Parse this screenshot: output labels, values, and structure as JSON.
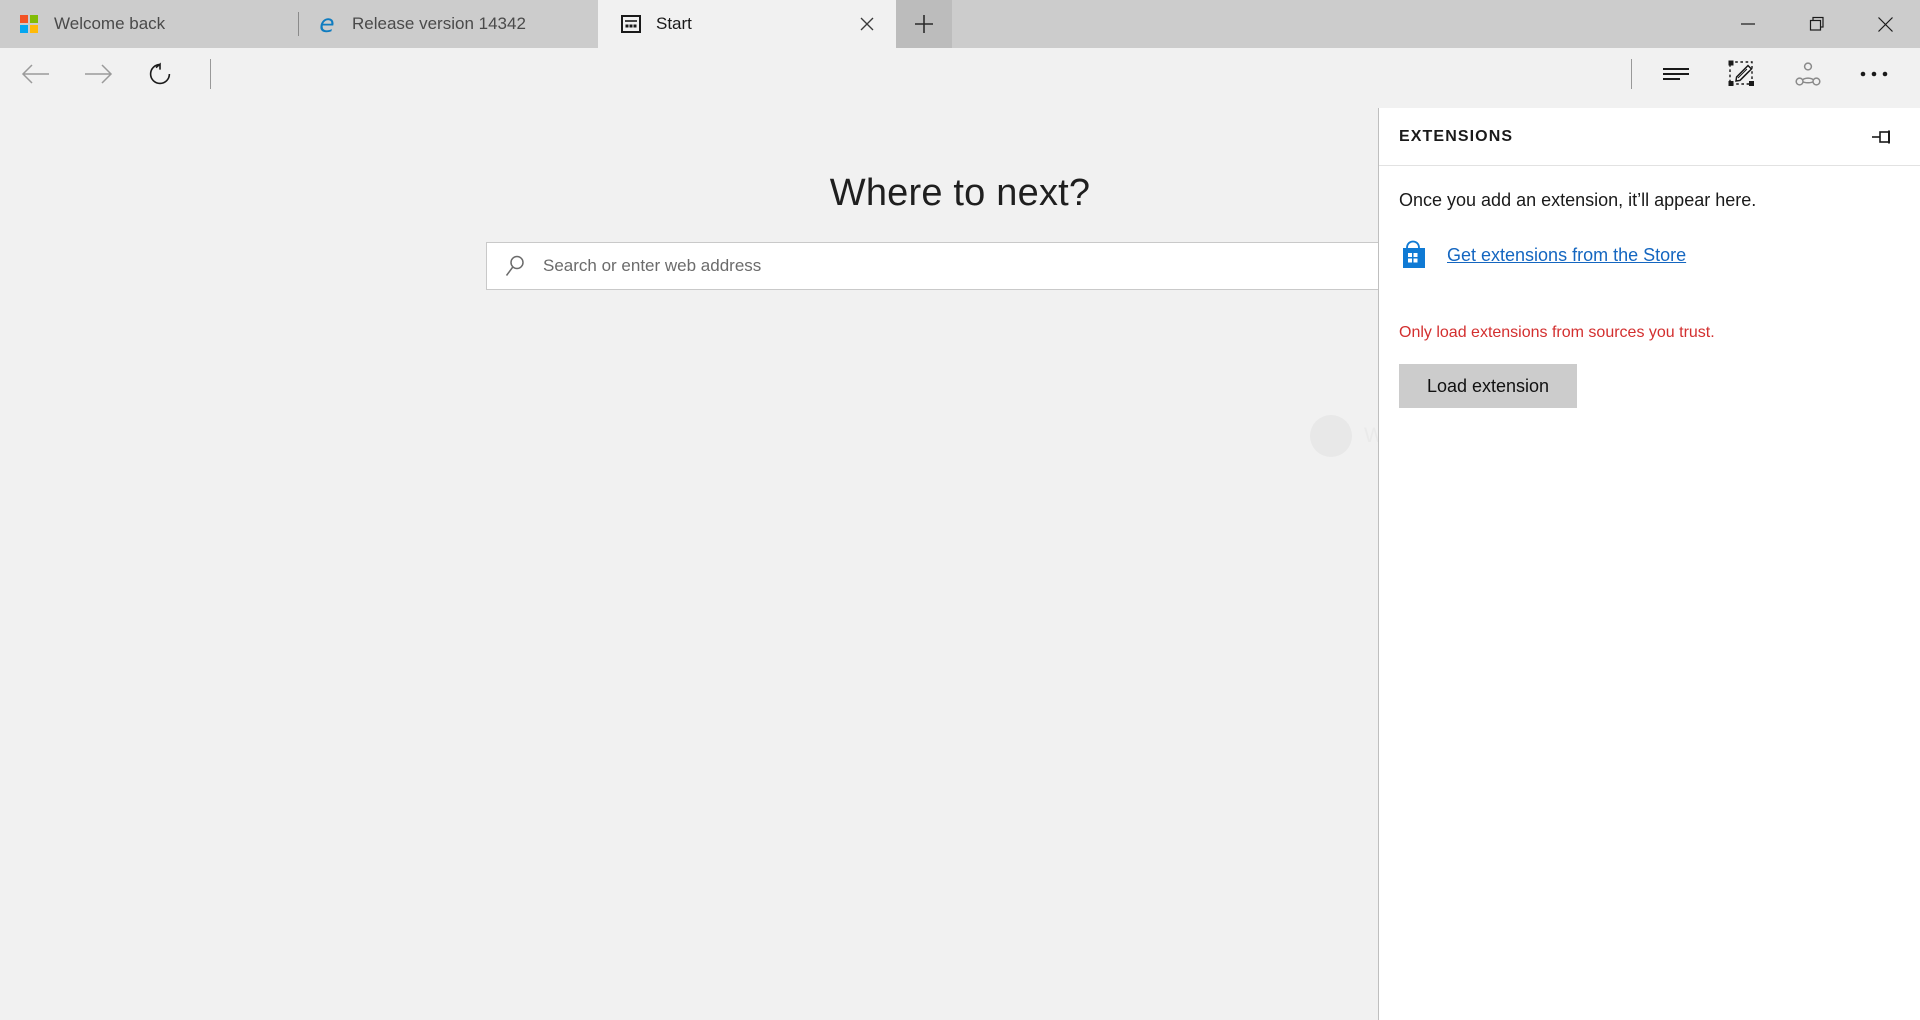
{
  "window": {
    "controls": {
      "minimize_label": "Minimize",
      "restore_label": "Restore",
      "close_label": "Close"
    }
  },
  "tabstrip": {
    "new_tab_label": "New tab",
    "tabs": [
      {
        "title": "Welcome back",
        "favicon": "windows-logo-icon",
        "active": false,
        "closable": false
      },
      {
        "title": "Release version 14342",
        "favicon": "edge-logo-icon",
        "active": false,
        "closable": false
      },
      {
        "title": "Start",
        "favicon": "start-page-icon",
        "active": true,
        "closable": true
      }
    ]
  },
  "toolbar": {
    "back_label": "Back",
    "forward_label": "Forward",
    "refresh_label": "Refresh",
    "reading_view_label": "Reading view",
    "web_note_label": "Make a Web Note",
    "share_label": "Share",
    "more_label": "More"
  },
  "page": {
    "heading": "Where to next?",
    "search": {
      "value": "",
      "placeholder": "Search or enter web address"
    },
    "watermark": {
      "text": "Windows"
    }
  },
  "panel": {
    "title": "EXTENSIONS",
    "pin_label": "Pin",
    "empty_message": "Once you add an extension, it’ll appear here.",
    "store_link": "Get extensions from the Store",
    "store_icon": "store-bag-icon",
    "warning": "Only load extensions from sources you trust.",
    "load_button": "Load extension"
  },
  "colors": {
    "tabstrip_bg": "#cccccc",
    "page_bg": "#f1f1f1",
    "panel_bg": "#ffffff",
    "link": "#1466c0",
    "warning": "#d32f2f",
    "button_bg": "#cccccc"
  }
}
